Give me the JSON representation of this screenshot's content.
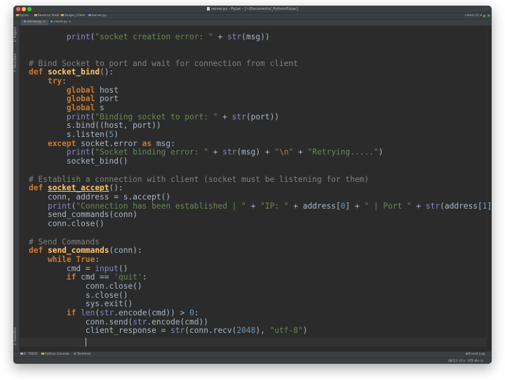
{
  "window": {
    "title": "server.py - PyLec - [~/Documents/_Python/PyLec]",
    "traffic_light_colors": [
      "#ff5f57",
      "#febc2e",
      "#28c840"
    ]
  },
  "navbar": {
    "breadcrumbs": [
      "PyLec",
      "Reverse Shell",
      "Single_Client",
      "server.py"
    ],
    "run_config": "client (1)",
    "run_icon": "play-icon",
    "debug_icon": "bug-icon",
    "stop_icon": "stop-icon"
  },
  "left_strip": {
    "top_tabs": [
      "1: Project",
      "7: Structure"
    ],
    "bottom_tabs": [
      "2: Favorites"
    ]
  },
  "editor_tabs": [
    {
      "label": "server.py",
      "active": true
    },
    {
      "label": "client.py",
      "active": false
    }
  ],
  "code": {
    "L1": {
      "indent": "        ",
      "fn": "print",
      "p1": "(",
      "s1": "\"socket creation error: \"",
      "p2": " + ",
      "bi1": "str",
      "p3": "(msg))"
    },
    "L2": {
      "comment": "# Bind Socket to port and wait for connection from client"
    },
    "L3": {
      "kw": "def",
      "sp": " ",
      "name": "socket_bind",
      "rest": "():"
    },
    "L4": {
      "indent": "    ",
      "kw": "try",
      "rest": ":"
    },
    "L5": {
      "indent": "        ",
      "kw": "global",
      "rest": " host"
    },
    "L6": {
      "indent": "        ",
      "kw": "global",
      "rest": " port"
    },
    "L7": {
      "indent": "        ",
      "kw": "global",
      "rest": " s"
    },
    "L8": {
      "indent": "        ",
      "fn": "print",
      "p1": "(",
      "s1": "\"Binding socket to port: \"",
      "p2": " + ",
      "bi1": "str",
      "p3": "(port))"
    },
    "L9": {
      "indent": "        ",
      "text": "s.bind((host, port))"
    },
    "L10": {
      "indent": "        ",
      "p1": "s.listen(",
      "n1": "5",
      "p2": ")"
    },
    "L11": {
      "indent": "    ",
      "kw1": "except",
      "p1": " socket.error ",
      "kw2": "as",
      "p2": " msg:"
    },
    "L12": {
      "indent": "        ",
      "fn": "print",
      "p1": "(",
      "s1": "\"Socket binding error: \"",
      "p2": " + ",
      "bi1": "str",
      "p3": "(msg) + ",
      "s2": "\"",
      "e1": "\\n",
      "s3": "\"",
      "p4": " + ",
      "s4": "\"Retrying.....\"",
      "p5": ")"
    },
    "L13": {
      "indent": "        ",
      "text": "socket_bind()"
    },
    "L14": {
      "comment": "# Establish a connection with client (socket must be listening for them)"
    },
    "L15": {
      "kw": "def",
      "sp": " ",
      "name": "socket_accept",
      "rest": "():"
    },
    "L16": {
      "indent": "    ",
      "text": "conn, address = s.accept()"
    },
    "L17": {
      "indent": "    ",
      "fn": "print",
      "p1": "(",
      "s1": "\"Connection has been established | \"",
      "p2": " + ",
      "s2": "\"IP: \"",
      "p3": " + address[",
      "n1": "0",
      "p4": "] + ",
      "s3": "\" | Port \"",
      "p5": " + ",
      "bi1": "str",
      "p6": "(address[",
      "n2": "1",
      "p7": "]))"
    },
    "L18": {
      "indent": "    ",
      "text": "send_commands(conn)"
    },
    "L19": {
      "indent": "    ",
      "text": "conn.close()"
    },
    "L20": {
      "comment": "# Send Commands"
    },
    "L21": {
      "kw": "def",
      "sp": " ",
      "name": "send_commands",
      "rest": "(conn):"
    },
    "L22": {
      "indent": "    ",
      "kw1": "while",
      "sp": " ",
      "kw2": "True",
      "rest": ":"
    },
    "L23": {
      "indent": "        ",
      "p1": "cmd = ",
      "bi1": "input",
      "p2": "()"
    },
    "L24": {
      "indent": "        ",
      "kw": "if",
      "p1": " cmd == ",
      "s1": "'quit'",
      "p2": ":"
    },
    "L25": {
      "indent": "            ",
      "text": "conn.close()"
    },
    "L26": {
      "indent": "            ",
      "text": "s.close()"
    },
    "L27": {
      "indent": "            ",
      "text": "sys.exit()"
    },
    "L28": {
      "indent": "        ",
      "kw": "if",
      "sp": " ",
      "bi1": "len",
      "p1": "(",
      "bi2": "str",
      "p2": ".encode(cmd)) > ",
      "n1": "0",
      "p3": ":"
    },
    "L29": {
      "indent": "            ",
      "p1": "conn.send(",
      "bi1": "str",
      "p2": ".encode(cmd))"
    },
    "L30": {
      "indent": "            ",
      "p1": "client_response = ",
      "bi1": "str",
      "p2": "(conn.recv(",
      "n1": "2048",
      "p3": "), ",
      "s1": "\"utf-8\"",
      "p4": ")"
    },
    "L31": {
      "indent": "            "
    }
  },
  "bottom_tabs": [
    "6: TODO",
    "Python Console",
    "Terminal"
  ],
  "status": {
    "event_log": "Event Log",
    "position": "48:13",
    "line_sep": "LF÷",
    "encoding": "UTF-8÷"
  }
}
